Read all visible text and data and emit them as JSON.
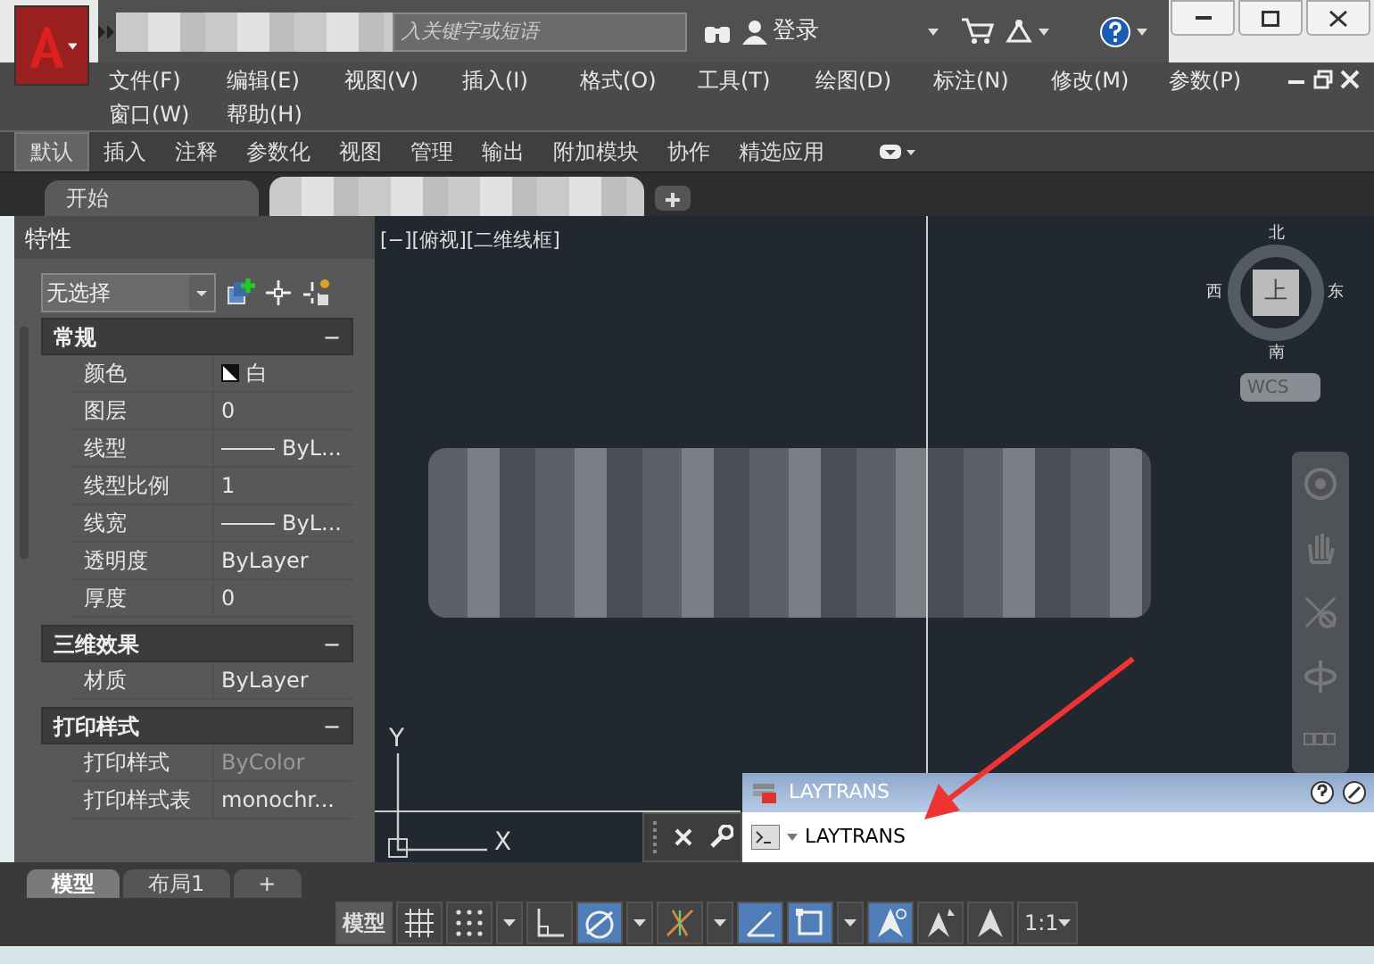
{
  "title_bar": {
    "search_placeholder": "入关键字或短语",
    "login": "登录"
  },
  "menu_bar": {
    "rows": [
      [
        "文件(F)",
        "编辑(E)",
        "视图(V)",
        "插入(I)",
        "格式(O)",
        "工具(T)",
        "绘图(D)",
        "标注(N)",
        "修改(M)",
        "参数(P)"
      ],
      [
        "窗口(W)",
        "帮助(H)"
      ]
    ]
  },
  "ribbon_tabs": [
    {
      "label": "默认",
      "selected": true
    },
    {
      "label": "插入",
      "selected": false
    },
    {
      "label": "注释",
      "selected": false
    },
    {
      "label": "参数化",
      "selected": false
    },
    {
      "label": "视图",
      "selected": false
    },
    {
      "label": "管理",
      "selected": false
    },
    {
      "label": "输出",
      "selected": false
    },
    {
      "label": "附加模块",
      "selected": false
    },
    {
      "label": "协作",
      "selected": false
    },
    {
      "label": "精选应用",
      "selected": false
    }
  ],
  "file_tabs": [
    {
      "label": "开始",
      "selected": false
    }
  ],
  "properties": {
    "title": "特性",
    "selection": "无选择",
    "sections": [
      {
        "title": "常规",
        "toggle": "−",
        "rows": [
          {
            "label": "颜色",
            "value": "白",
            "kind": "color",
            "disabled": false
          },
          {
            "label": "图层",
            "value": "0",
            "kind": "text",
            "disabled": false
          },
          {
            "label": "线型",
            "value": "ByL...",
            "kind": "line",
            "disabled": false
          },
          {
            "label": "线型比例",
            "value": "1",
            "kind": "text",
            "disabled": false
          },
          {
            "label": "线宽",
            "value": "ByL...",
            "kind": "line",
            "disabled": false
          },
          {
            "label": "透明度",
            "value": "ByLayer",
            "kind": "text",
            "disabled": false
          },
          {
            "label": "厚度",
            "value": "0",
            "kind": "text",
            "disabled": false
          }
        ]
      },
      {
        "title": "三维效果",
        "toggle": "−",
        "rows": [
          {
            "label": "材质",
            "value": "ByLayer",
            "kind": "text",
            "disabled": false
          }
        ]
      },
      {
        "title": "打印样式",
        "toggle": "−",
        "rows": [
          {
            "label": "打印样式",
            "value": "ByColor",
            "kind": "text",
            "disabled": true
          },
          {
            "label": "打印样式表",
            "value": "monochr...",
            "kind": "text",
            "disabled": false
          }
        ]
      }
    ]
  },
  "viewport": {
    "label": "[−][俯视][二维线框]",
    "viewcube": {
      "north": "北",
      "south": "南",
      "east": "东",
      "west": "西",
      "face": "上",
      "coords": "WCS"
    },
    "ucs": {
      "x": "X",
      "y": "Y"
    }
  },
  "command_line": {
    "title": "LAYTRANS",
    "value": "LAYTRANS"
  },
  "layout_tabs": [
    {
      "label": "模型",
      "selected": true
    },
    {
      "label": "布局1",
      "selected": false
    },
    {
      "label": "+",
      "selected": false
    }
  ],
  "status_bar": {
    "model": "模型",
    "toggles": [
      {
        "kind": "grid",
        "on": false
      },
      {
        "kind": "snap",
        "on": false
      },
      {
        "kind": "ortho",
        "on": false
      },
      {
        "kind": "polar",
        "on": true
      },
      {
        "kind": "iso",
        "on": false
      },
      {
        "kind": "track",
        "on": true
      },
      {
        "kind": "osnap",
        "on": true
      },
      {
        "kind": "annotate",
        "on": true
      },
      {
        "kind": "autoscale",
        "on": false
      },
      {
        "kind": "annoscale",
        "on": false
      }
    ],
    "scale": "1:1"
  }
}
